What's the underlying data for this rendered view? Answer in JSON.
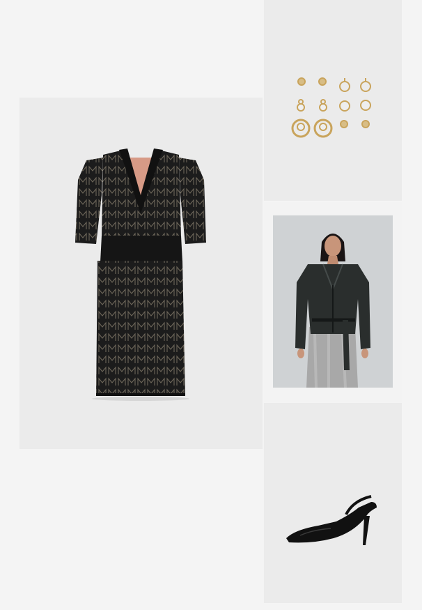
{
  "outfit": {
    "items": [
      {
        "name": "dress",
        "icon": "knit-dress-image",
        "background": "#ebebeb"
      },
      {
        "name": "earrings",
        "icon": "earrings-set-image",
        "background": "#ebebeb"
      },
      {
        "name": "jacket",
        "icon": "leather-jacket-model-image",
        "background": "#cfd2d4"
      },
      {
        "name": "shoes",
        "icon": "slingback-heel-image",
        "background": "#ebebeb"
      }
    ]
  },
  "colors": {
    "page": "#f4f4f4",
    "dress": "#1c1c1c",
    "dress_pattern": "#6d6659",
    "dress_lining": "#d79a86",
    "gold": "#c9a45c",
    "jacket": "#2a2e2d",
    "sequin": "#a8a8a8",
    "shoe": "#111111"
  }
}
